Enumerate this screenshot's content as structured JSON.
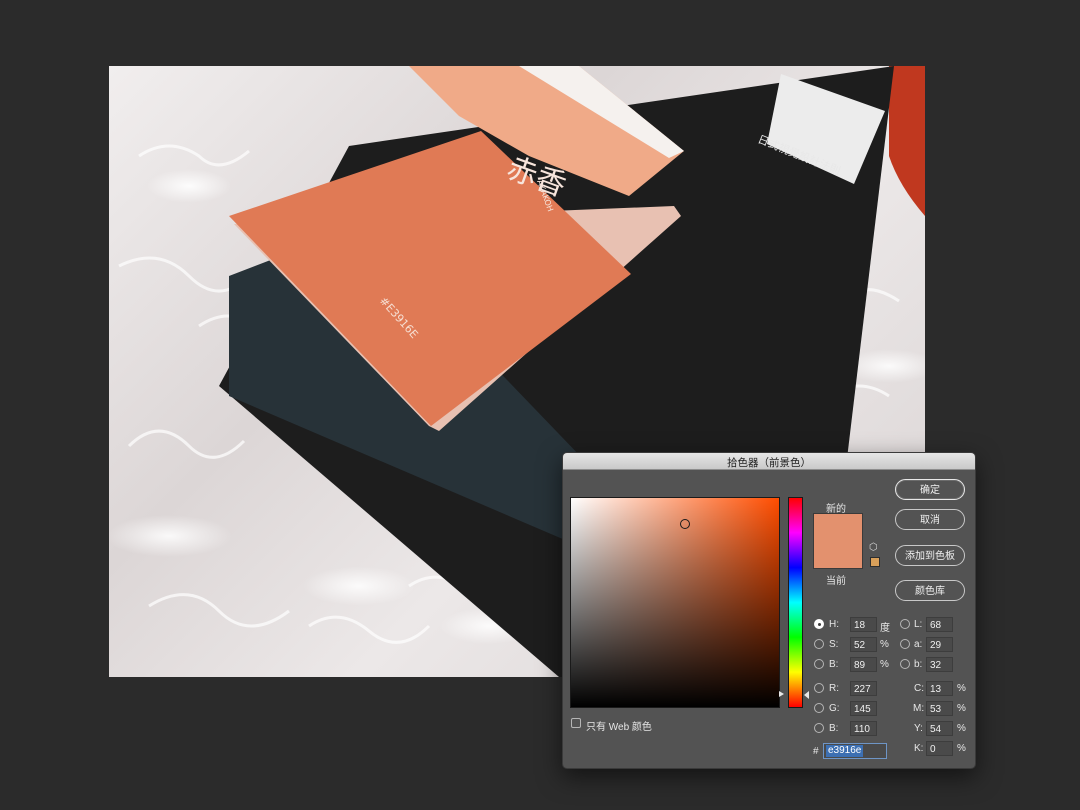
{
  "photo": {
    "book_spine_text": "#E3916E",
    "book_title": "赤香",
    "book_romaji": "AKAKOH",
    "notebook_title": "日式視覺設計法則"
  },
  "dialog": {
    "title": "拾色器（前景色）",
    "new_label": "新的",
    "current_label": "当前",
    "new_color": "#e3916e",
    "current_color": "#e3916e",
    "buttons": {
      "ok": "确定",
      "cancel": "取消",
      "add_to_swatches": "添加到色板",
      "color_libraries": "颜色库"
    },
    "only_web_colors": "只有 Web 颜色",
    "hsb": {
      "h": {
        "label": "H:",
        "value": "18",
        "unit": "度"
      },
      "s": {
        "label": "S:",
        "value": "52",
        "unit": "%"
      },
      "b": {
        "label": "B:",
        "value": "89",
        "unit": "%"
      }
    },
    "rgb": {
      "r": {
        "label": "R:",
        "value": "227"
      },
      "g": {
        "label": "G:",
        "value": "145"
      },
      "b": {
        "label": "B:",
        "value": "110"
      }
    },
    "lab": {
      "l": {
        "label": "L:",
        "value": "68"
      },
      "a": {
        "label": "a:",
        "value": "29"
      },
      "b": {
        "label": "b:",
        "value": "32"
      }
    },
    "cmyk": {
      "c": {
        "label": "C:",
        "value": "13",
        "unit": "%"
      },
      "m": {
        "label": "M:",
        "value": "53",
        "unit": "%"
      },
      "y": {
        "label": "Y:",
        "value": "54",
        "unit": "%"
      },
      "k": {
        "label": "K:",
        "value": "0",
        "unit": "%"
      }
    },
    "hex_prefix": "#",
    "hex_value": "e3916e"
  }
}
